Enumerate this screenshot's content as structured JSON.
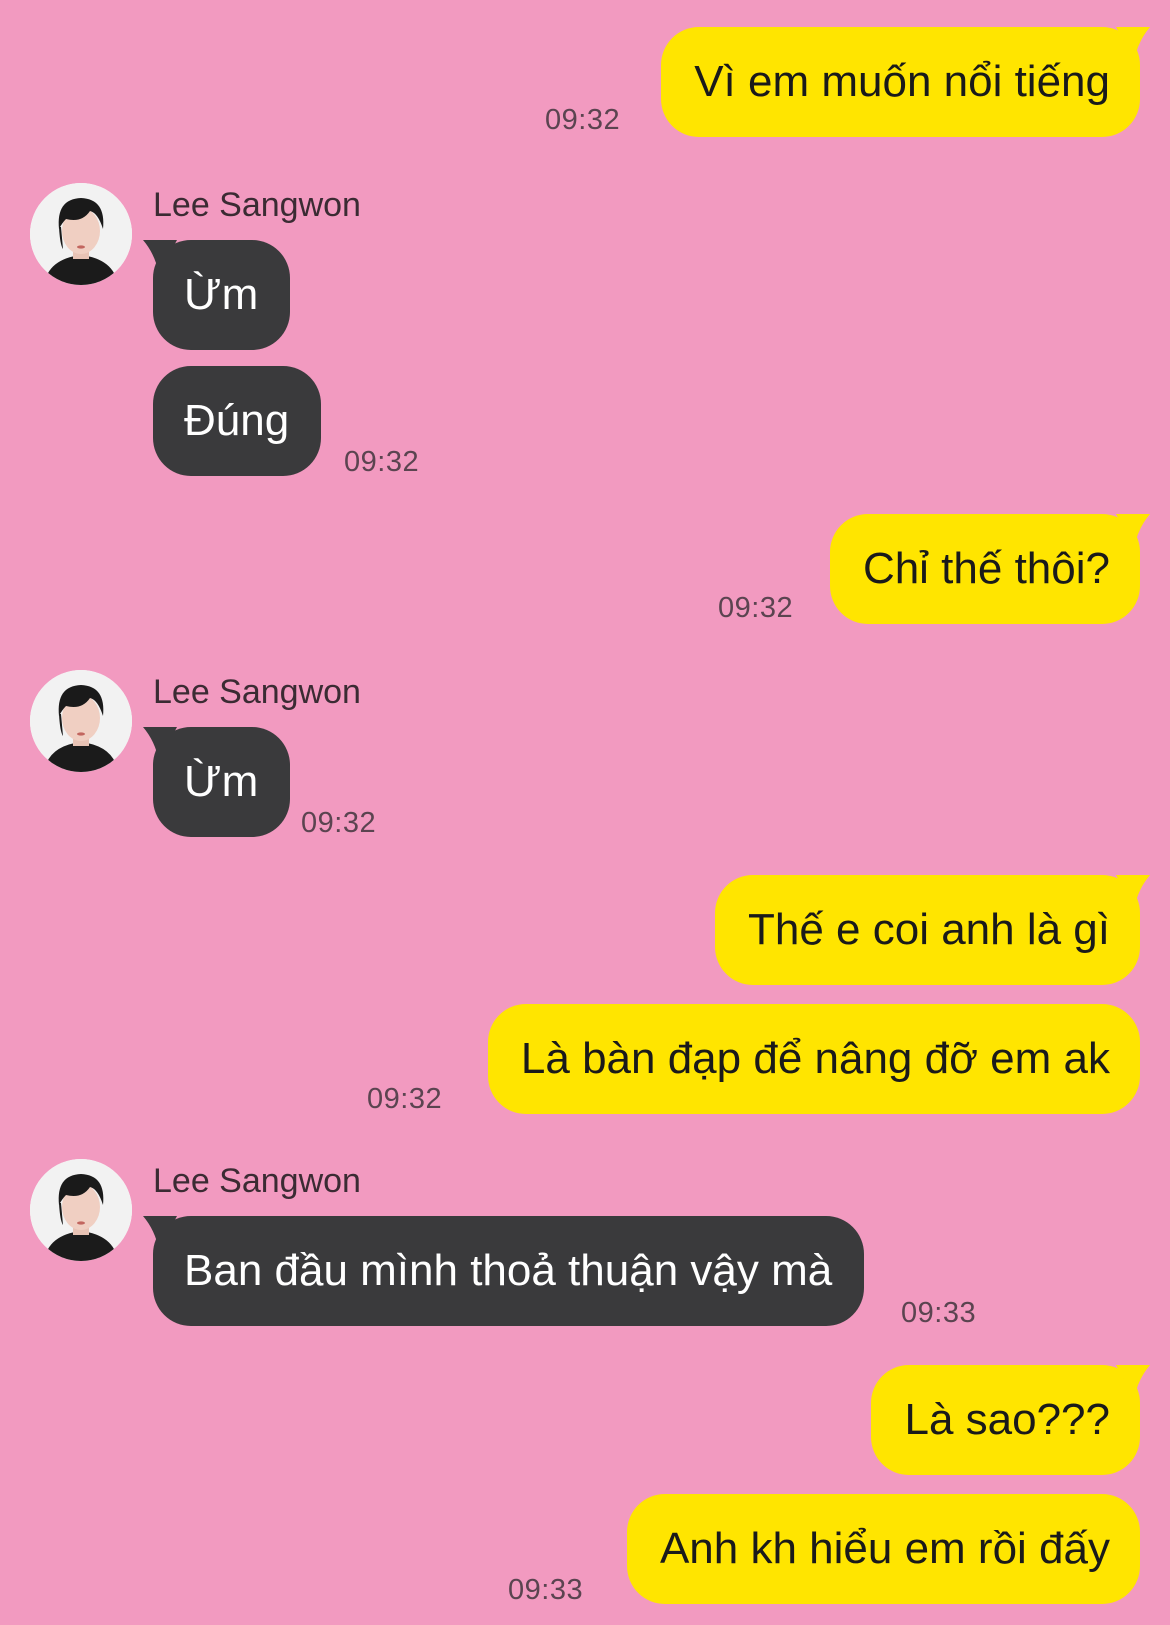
{
  "colors": {
    "background": "#f29ac0",
    "outgoing_bubble": "#ffe500",
    "incoming_bubble": "#3a3a3c"
  },
  "conversation": {
    "contact_name": "Lee Sangwon",
    "messages": [
      {
        "direction": "out",
        "text": "Vì em muốn nổi tiếng",
        "time": "09:32"
      },
      {
        "direction": "in",
        "text": "Ừm"
      },
      {
        "direction": "in",
        "text": "Đúng",
        "time": "09:32"
      },
      {
        "direction": "out",
        "text": "Chỉ thế thôi?",
        "time": "09:32"
      },
      {
        "direction": "in",
        "text": "Ừm",
        "time": "09:32"
      },
      {
        "direction": "out",
        "text": "Thế e coi anh là gì"
      },
      {
        "direction": "out",
        "text": "Là bàn đạp để nâng đỡ em ak",
        "time": "09:32"
      },
      {
        "direction": "in",
        "text": "Ban đầu mình thoả thuận vậy mà",
        "time": "09:33"
      },
      {
        "direction": "out",
        "text": "Là sao???"
      },
      {
        "direction": "out",
        "text": "Anh kh hiểu em rồi đấy",
        "time": "09:33"
      }
    ]
  }
}
